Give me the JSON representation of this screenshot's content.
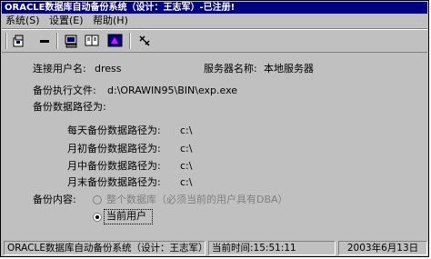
{
  "window": {
    "title": "ORACLE数据库自动备份系统（设计：王志军）-已注册!"
  },
  "menu": {
    "items": [
      {
        "label": "系统(S)"
      },
      {
        "label": "设置(E)"
      },
      {
        "label": "帮助(H)"
      }
    ]
  },
  "toolbar": {
    "icons": [
      "connect-icon",
      "disconnect-icon",
      "settings-icon",
      "backup-icon",
      "restore-icon",
      "help-icon"
    ]
  },
  "info": {
    "user_label": "连接用户名:",
    "user_value": "dress",
    "server_label": "服务器名称:",
    "server_value": "本地服务器",
    "exe_label": "备份执行文件:",
    "exe_value": "d:\\ORAWIN95\\BIN\\exp.exe",
    "path_header": "备份数据路径为:"
  },
  "paths": {
    "daily_label": "每天备份数据路径为:",
    "daily_value": "c:\\",
    "month_start_label": "月初备份数据路径为:",
    "month_start_value": "c:\\",
    "month_mid_label": "月中备份数据路径为:",
    "month_mid_value": "c:\\",
    "month_end_label": "月末备份数据路径为:",
    "month_end_value": "c:\\"
  },
  "backup_content": {
    "label": "备份内容:",
    "option_full": "整个数据库（必须当前的用户具有DBA）",
    "option_current": "当前用户",
    "selected": "当前用户"
  },
  "status": {
    "app": "ORACLE数据库自动备份系统（设计：王志军）",
    "time_label": "当前时间:",
    "time_value": "15:51:11",
    "date": "2003年6月13日"
  },
  "colors": {
    "titlebar": "#000080",
    "face": "#c0c0c0"
  }
}
